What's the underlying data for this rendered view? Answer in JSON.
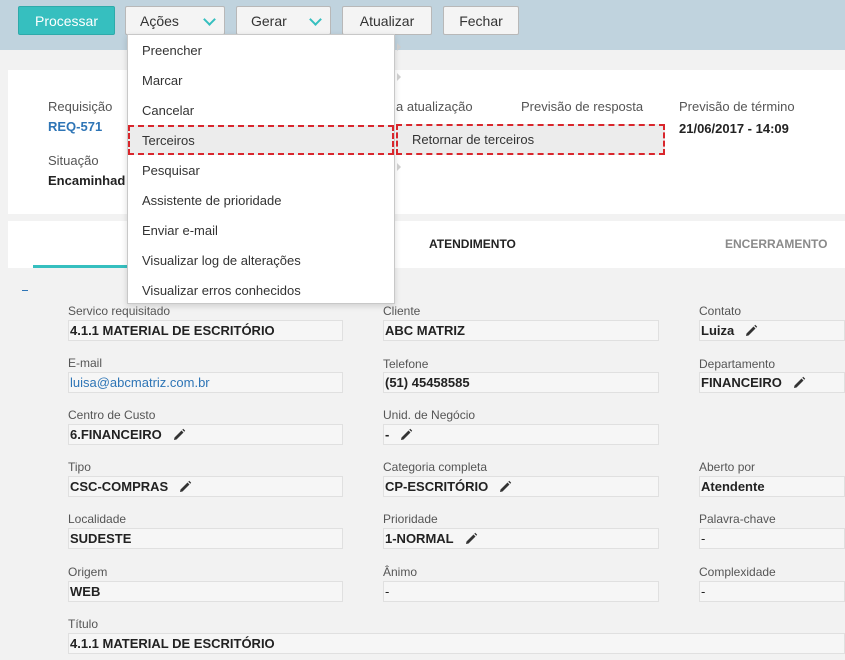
{
  "toolbar": {
    "processar": "Processar",
    "acoes": "Ações",
    "gerar": "Gerar",
    "atualizar": "Atualizar",
    "fechar": "Fechar"
  },
  "header": {
    "requisicao_label": "Requisição",
    "requisicao_value": "REQ-571",
    "ultima_atualizacao_label": "a atualização",
    "previsao_resposta_label": "Previsão de resposta",
    "previsao_termino_label": "Previsão de término",
    "previsao_termino_value": "21/06/2017 - 14:09",
    "situacao_label": "Situação",
    "situacao_value": "Encaminhad"
  },
  "tabs": {
    "atendimento": "ATENDIMENTO",
    "encerramento": "ENCERRAMENTO"
  },
  "menu": {
    "items": [
      "Preencher",
      "Marcar",
      "Cancelar",
      "Terceiros",
      "Pesquisar",
      "Assistente de prioridade",
      "Enviar e-mail",
      "Visualizar log de alterações",
      "Visualizar erros conhecidos"
    ],
    "submenu": "Retornar de terceiros"
  },
  "fields": {
    "servico_label": "Servico requisitado",
    "servico_value": "4.1.1 MATERIAL DE ESCRITÓRIO",
    "cliente_label": "Cliente",
    "cliente_value": "ABC MATRIZ",
    "contato_label": "Contato",
    "contato_value": "Luiza",
    "email_label": "E-mail",
    "email_value": "luisa@abcmatriz.com.br",
    "telefone_label": "Telefone",
    "telefone_value": "(51) 45458585",
    "departamento_label": "Departamento",
    "departamento_value": "FINANCEIRO",
    "centro_label": "Centro de Custo",
    "centro_value": "6.FINANCEIRO",
    "unid_label": "Unid. de Negócio",
    "unid_value": "-",
    "tipo_label": "Tipo",
    "tipo_value": "CSC-COMPRAS",
    "categoria_label": "Categoria completa",
    "categoria_value": "CP-ESCRITÓRIO",
    "aberto_label": "Aberto por",
    "aberto_value": "Atendente",
    "localidade_label": "Localidade",
    "localidade_value": "SUDESTE",
    "prioridade_label": "Prioridade",
    "prioridade_value": "1-NORMAL",
    "palavra_label": "Palavra-chave",
    "palavra_value": "-",
    "origem_label": "Origem",
    "origem_value": "WEB",
    "animo_label": "Ânimo",
    "animo_value": "-",
    "complexidade_label": "Complexidade",
    "complexidade_value": "-",
    "titulo_label": "Título",
    "titulo_value": "4.1.1 MATERIAL DE ESCRITÓRIO"
  }
}
